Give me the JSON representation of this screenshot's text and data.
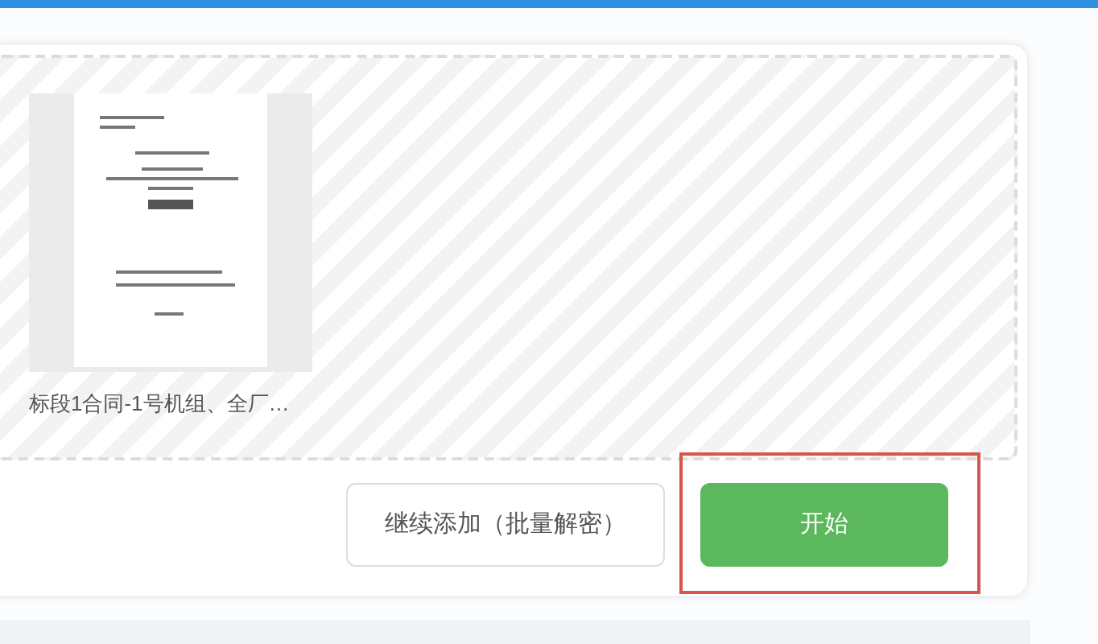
{
  "files": [
    {
      "name": "标段1合同-1号机组、全厂…"
    }
  ],
  "buttons": [
    {
      "label": "继续添加（批量解密）",
      "kind": "secondary"
    },
    {
      "label": "开始",
      "kind": "primary",
      "highlighted": true
    }
  ]
}
